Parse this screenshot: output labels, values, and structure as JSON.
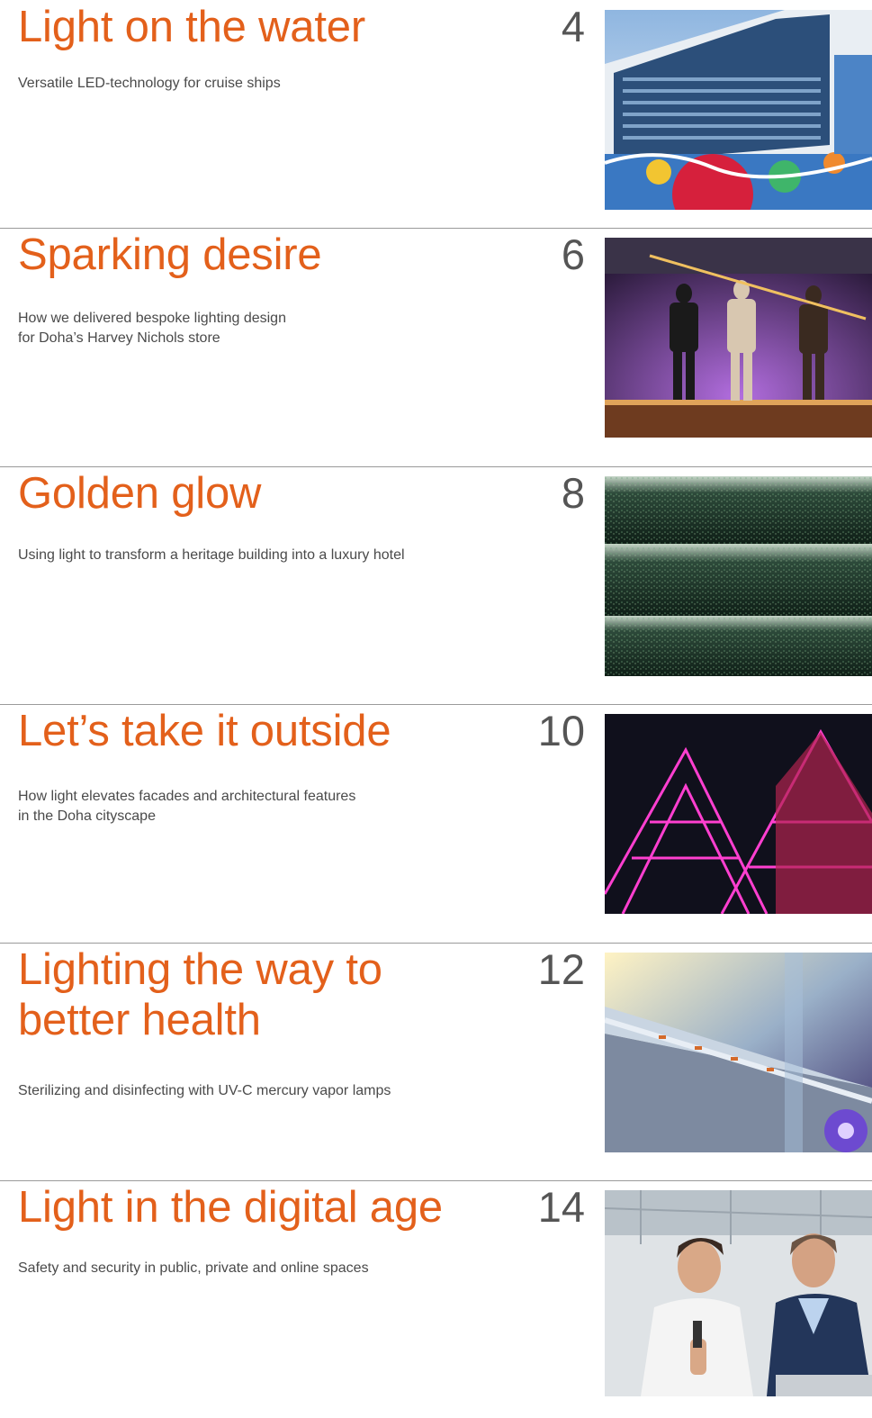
{
  "entries": [
    {
      "title": "Light on the water",
      "subtitle": "Versatile LED-technology for cruise ships",
      "page": "4"
    },
    {
      "title": "Sparking desire",
      "subtitle": "How we delivered bespoke lighting design\nfor Doha’s Harvey Nichols store",
      "page": "6"
    },
    {
      "title": "Golden glow",
      "subtitle": "Using light to transform a heritage building into a luxury hotel",
      "page": "8"
    },
    {
      "title": "Let’s take it outside",
      "subtitle": "How light elevates facades and architectural features\nin the Doha cityscape",
      "page": "10"
    },
    {
      "title": "Lighting the way to better health",
      "subtitle": "Sterilizing and disinfecting with UV-C mercury vapor lamps",
      "page": "12"
    },
    {
      "title": "Light in the digital age",
      "subtitle": "Safety and security in public, private and online spaces",
      "page": "14"
    }
  ],
  "colors": {
    "accent": "#e3601b",
    "text": "#4a4a4a",
    "page_number": "#555555",
    "divider": "#9a9a9a"
  }
}
